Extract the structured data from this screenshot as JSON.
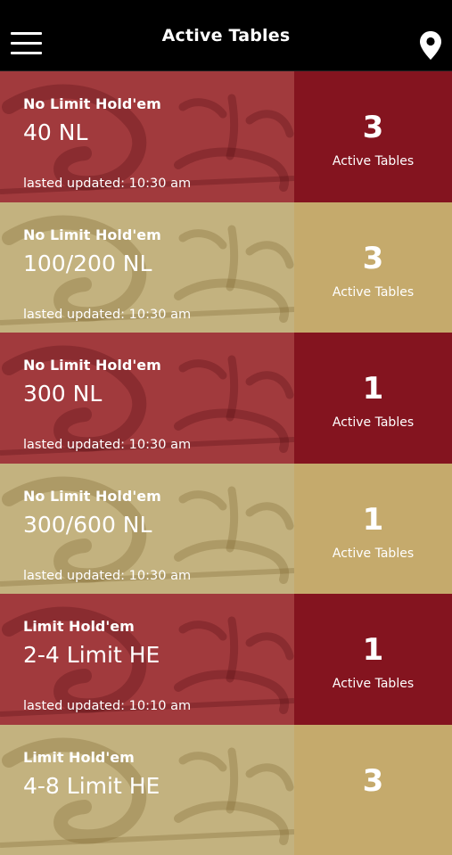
{
  "header": {
    "title": "Active Tables",
    "menu_icon": "hamburger-menu-icon",
    "location_icon": "location-pin-icon"
  },
  "colors": {
    "red_left": "#a13a3d",
    "red_right": "#84141f",
    "gold_left": "#c3b27f",
    "gold_right": "#c5aa6c"
  },
  "tables": [
    {
      "game": "No Limit Hold'em",
      "stakes": "40 NL",
      "updated": "lasted updated: 10:30 am",
      "count": "3",
      "count_label": "Active Tables",
      "theme": "red"
    },
    {
      "game": "No Limit Hold'em",
      "stakes": "100/200 NL",
      "updated": "lasted updated: 10:30 am",
      "count": "3",
      "count_label": "Active Tables",
      "theme": "gold"
    },
    {
      "game": "No Limit Hold'em",
      "stakes": "300 NL",
      "updated": "lasted updated: 10:30 am",
      "count": "1",
      "count_label": "Active Tables",
      "theme": "red"
    },
    {
      "game": "No Limit Hold'em",
      "stakes": "300/600 NL",
      "updated": "lasted updated: 10:30 am",
      "count": "1",
      "count_label": "Active Tables",
      "theme": "gold"
    },
    {
      "game": "Limit Hold'em",
      "stakes": "2-4 Limit HE",
      "updated": "lasted updated: 10:10 am",
      "count": "1",
      "count_label": "Active Tables",
      "theme": "red"
    },
    {
      "game": "Limit Hold'em",
      "stakes": "4-8 Limit HE",
      "updated": "",
      "count": "3",
      "count_label": "",
      "theme": "gold"
    }
  ]
}
